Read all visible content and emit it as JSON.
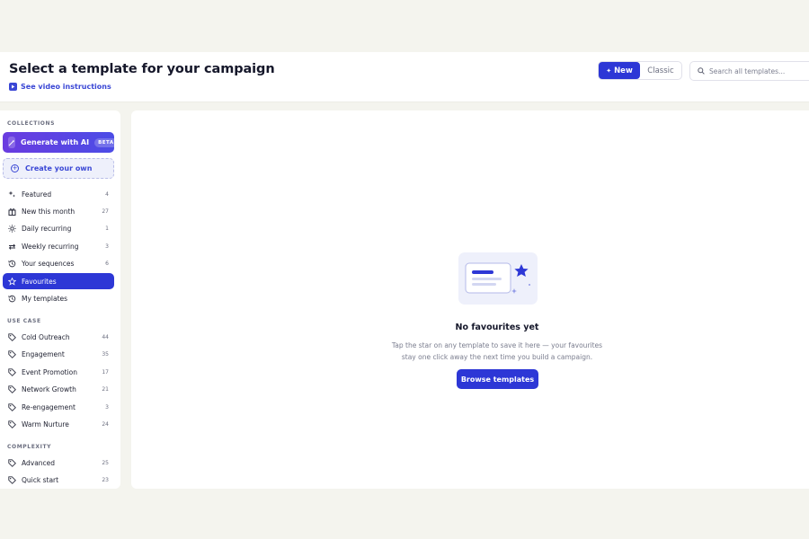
{
  "header": {
    "title": "Select a template for your campaign",
    "video_link": "See video instructions",
    "toggle": {
      "new_label": "New",
      "classic_label": "Classic",
      "selected": "New"
    },
    "search_placeholder": "Search all templates..."
  },
  "sidebar": {
    "collections_label": "COLLECTIONS",
    "generate_ai": {
      "label": "Generate with AI",
      "badge": "BETA"
    },
    "create_own": "Create your own",
    "collections": [
      {
        "label": "Featured",
        "count": "4",
        "icon": "sparkles-icon"
      },
      {
        "label": "New this month",
        "count": "27",
        "icon": "gift-icon"
      },
      {
        "label": "Daily recurring",
        "count": "1",
        "icon": "sun-icon"
      },
      {
        "label": "Weekly recurring",
        "count": "3",
        "icon": "repeat-icon"
      },
      {
        "label": "Your sequences",
        "count": "6",
        "icon": "history-icon"
      },
      {
        "label": "Favourites",
        "count": "",
        "icon": "star-icon",
        "active": true
      },
      {
        "label": "My templates",
        "count": "",
        "icon": "history-icon"
      }
    ],
    "use_case_label": "USE CASE",
    "use_cases": [
      {
        "label": "Cold Outreach",
        "count": "44",
        "icon": "tag-icon"
      },
      {
        "label": "Engagement",
        "count": "35",
        "icon": "tag-icon"
      },
      {
        "label": "Event Promotion",
        "count": "17",
        "icon": "tag-icon"
      },
      {
        "label": "Network Growth",
        "count": "21",
        "icon": "tag-icon"
      },
      {
        "label": "Re-engagement",
        "count": "3",
        "icon": "tag-icon"
      },
      {
        "label": "Warm Nurture",
        "count": "24",
        "icon": "tag-icon"
      }
    ],
    "complexity_label": "COMPLEXITY",
    "complexity": [
      {
        "label": "Advanced",
        "count": "25",
        "icon": "tag-icon"
      },
      {
        "label": "Quick start",
        "count": "23",
        "icon": "tag-icon"
      }
    ]
  },
  "main": {
    "empty_title": "No favourites yet",
    "empty_line1": "Tap the star on any template to save it here — your favourites",
    "empty_line2": "stay one click away the next time you build a campaign.",
    "browse_button": "Browse templates"
  },
  "colors": {
    "accent": "#2d37d6",
    "ai_gradient_start": "#6a3ce0",
    "page_bg": "#f4f4ee"
  }
}
